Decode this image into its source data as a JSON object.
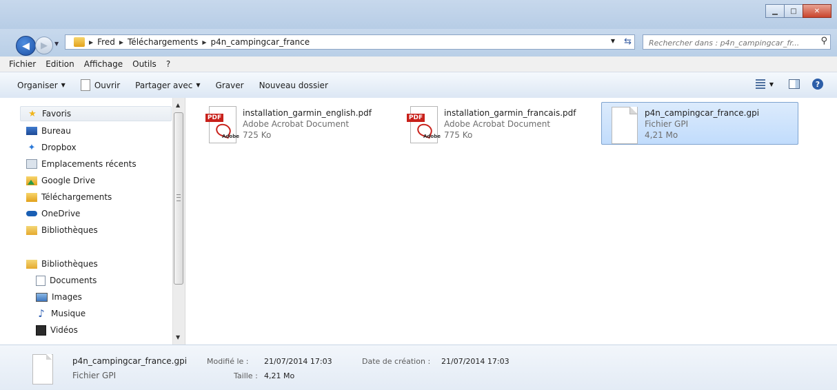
{
  "window": {
    "minimize_glyph": "▁",
    "maximize_glyph": "□",
    "close_glyph": "✕"
  },
  "navigation": {
    "back_glyph": "◀",
    "forward_glyph": "▶",
    "breadcrumb": [
      "Fred",
      "Téléchargements",
      "p4n_campingcar_france"
    ],
    "search_placeholder": "Rechercher dans : p4n_campingcar_fr..."
  },
  "menu": [
    "Fichier",
    "Edition",
    "Affichage",
    "Outils",
    "?"
  ],
  "toolbar": {
    "organize": "Organiser",
    "open": "Ouvrir",
    "share": "Partager avec",
    "burn": "Graver",
    "new_folder": "Nouveau dossier"
  },
  "sidebar": {
    "favorites_header": "Favoris",
    "favorites": [
      "Bureau",
      "Dropbox",
      "Emplacements récents",
      "Google Drive",
      "Téléchargements",
      "OneDrive",
      "Bibliothèques"
    ],
    "libraries_header": "Bibliothèques",
    "libraries": [
      "Documents",
      "Images",
      "Musique",
      "Vidéos"
    ]
  },
  "files": [
    {
      "name": "installation_garmin_english.pdf",
      "type": "Adobe Acrobat Document",
      "size": "725 Ko",
      "icon": "pdf-icon",
      "icon_label": "PDF",
      "icon_brand": "Adobe"
    },
    {
      "name": "installation_garmin_francais.pdf",
      "type": "Adobe Acrobat Document",
      "size": "775 Ko",
      "icon": "pdf-icon",
      "icon_label": "PDF",
      "icon_brand": "Adobe"
    },
    {
      "name": "p4n_campingcar_france.gpi",
      "type": "Fichier GPI",
      "size": "4,21 Mo",
      "icon": "generic-file-icon",
      "selected": true
    }
  ],
  "details": {
    "name": "p4n_campingcar_france.gpi",
    "type": "Fichier GPI",
    "modified_label": "Modifié le :",
    "modified_value": "21/07/2014 17:03",
    "size_label": "Taille :",
    "size_value": "4,21 Mo",
    "created_label": "Date de création :",
    "created_value": "21/07/2014 17:03"
  }
}
